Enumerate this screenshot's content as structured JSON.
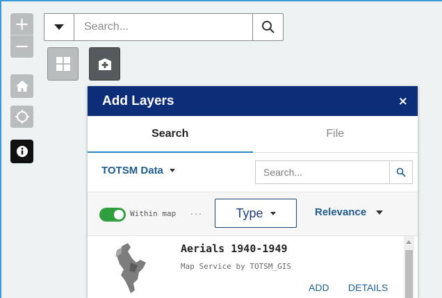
{
  "map_controls": {
    "zoom_in": "+",
    "zoom_out": "−",
    "info": "i"
  },
  "top_search": {
    "placeholder": "Search..."
  },
  "panel": {
    "title": "Add Layers",
    "close": "×",
    "tabs": [
      {
        "label": "Search",
        "active": true
      },
      {
        "label": "File",
        "active": false
      }
    ],
    "source_label": "TOTSM Data",
    "search_placeholder": "Search...",
    "within_map_label": "Within map",
    "within_map_more": "...",
    "within_map_on": true,
    "type_label": "Type",
    "sort_label": "Relevance",
    "results": [
      {
        "title": "Aerials 1940-1949",
        "subtitle": "Map Service by TOTSM_GIS",
        "add_label": "ADD",
        "details_label": "DETAILS"
      }
    ]
  },
  "colors": {
    "panel_header": "#0c2d77",
    "accent_link": "#1d5b8f",
    "toggle_on": "#2e9e3f",
    "map_border": "#3a9ad9"
  }
}
